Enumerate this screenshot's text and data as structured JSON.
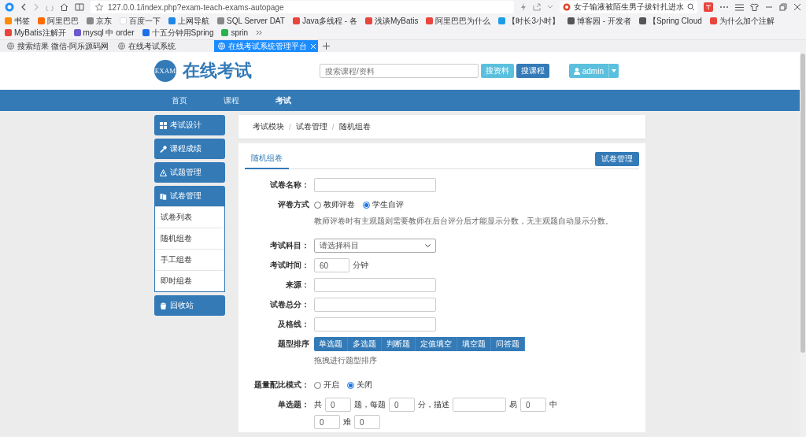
{
  "browser": {
    "address": "127.0.0.1/index.php?exam-teach-exams-autopage",
    "search": "女子输液被陌生男子拔针扎进水",
    "bookmarks": [
      "书签",
      "阿里巴巴",
      "京东",
      "百度一下",
      "上网导航",
      "SQL Server DAT",
      "Java多线程 - 各",
      "浅谈MyBatis",
      "阿里巴巴为什么",
      "【时长3小时】",
      "博客园 - 开发者",
      "【Spring Cloud",
      "为什么加个注解",
      "MyBatis注解开",
      "mysql 中 order",
      "十五分钟用Spring",
      "sprin"
    ],
    "tabs": [
      {
        "title": "搜索结果 微信-阿乐源码网",
        "selected": false
      },
      {
        "title": "在线考试系统",
        "selected": false
      },
      {
        "title": "在线考试系统管理平台",
        "selected": true
      }
    ]
  },
  "header": {
    "logo": "EXAM",
    "title": "在线考试",
    "search": {
      "placeholder": "搜索课程/资料"
    },
    "buttons": [
      "搜资料",
      "搜课程"
    ],
    "user": "admin"
  },
  "nav": [
    {
      "label": "首页",
      "selected": false
    },
    {
      "label": "课程",
      "selected": false
    },
    {
      "label": "考试",
      "selected": true
    }
  ],
  "sidebar": [
    {
      "label": "考试设计",
      "expanded": false
    },
    {
      "label": "课程成绩",
      "expanded": false
    },
    {
      "label": "试题管理",
      "expanded": false
    },
    {
      "label": "试卷管理",
      "expanded": true,
      "children": [
        {
          "label": "试卷列表"
        },
        {
          "label": "随机组卷"
        },
        {
          "label": "手工组卷"
        },
        {
          "label": "即时组卷"
        }
      ]
    },
    {
      "label": "回收站",
      "expanded": false
    }
  ],
  "breadcrumb": {
    "separator": "/",
    "items": [
      "考试模块",
      "试卷管理",
      "随机组卷"
    ]
  },
  "panel": {
    "tabs": [
      {
        "label": "随机组卷",
        "selected": true
      }
    ],
    "button": "试卷管理",
    "fields": [
      {
        "kind": "text",
        "label": "试卷名称："
      },
      {
        "kind": "radio",
        "label": "评卷方式",
        "options": [
          {
            "label": "教师评卷",
            "selected": false
          },
          {
            "label": "学生自评",
            "selected": true
          }
        ],
        "help": "教师评卷时有主观题则需要教师在后台评分后才能显示分数，无主观题自动显示分数。"
      },
      {
        "kind": "select",
        "label": "考试科目：",
        "value": "请选择科目"
      },
      {
        "kind": "short",
        "label": "考试时间：",
        "value": "60",
        "suffix": "分钟"
      },
      {
        "kind": "text",
        "label": "来源："
      },
      {
        "kind": "text",
        "label": "试卷总分："
      },
      {
        "kind": "text",
        "label": "及格线："
      },
      {
        "kind": "sortable",
        "label": "题型排序",
        "items": [
          "单选题",
          "多选题",
          "判断题",
          "定值填空",
          "填空题",
          "问答题"
        ],
        "help": "拖拽进行题型排序"
      },
      {
        "kind": "radio",
        "label": "题量配比模式：",
        "options": [
          {
            "label": "开启",
            "selected": false
          },
          {
            "label": "关闭",
            "selected": true
          }
        ]
      },
      {
        "kind": "ratio",
        "label": "单选题：",
        "parts": [
          {
            "kind": "text",
            "text": "共"
          },
          {
            "kind": "input",
            "value": "0"
          },
          {
            "kind": "text",
            "text": "题，每题"
          },
          {
            "kind": "input",
            "value": "0"
          },
          {
            "kind": "text",
            "text": "分，描述"
          },
          {
            "kind": "wide"
          },
          {
            "kind": "text",
            "text": "易"
          },
          {
            "kind": "input",
            "value": "0"
          },
          {
            "kind": "text",
            "text": "中"
          },
          {
            "kind": "input",
            "value": "0"
          },
          {
            "kind": "text",
            "text": "难"
          },
          {
            "kind": "input",
            "value": "0"
          }
        ]
      }
    ]
  }
}
